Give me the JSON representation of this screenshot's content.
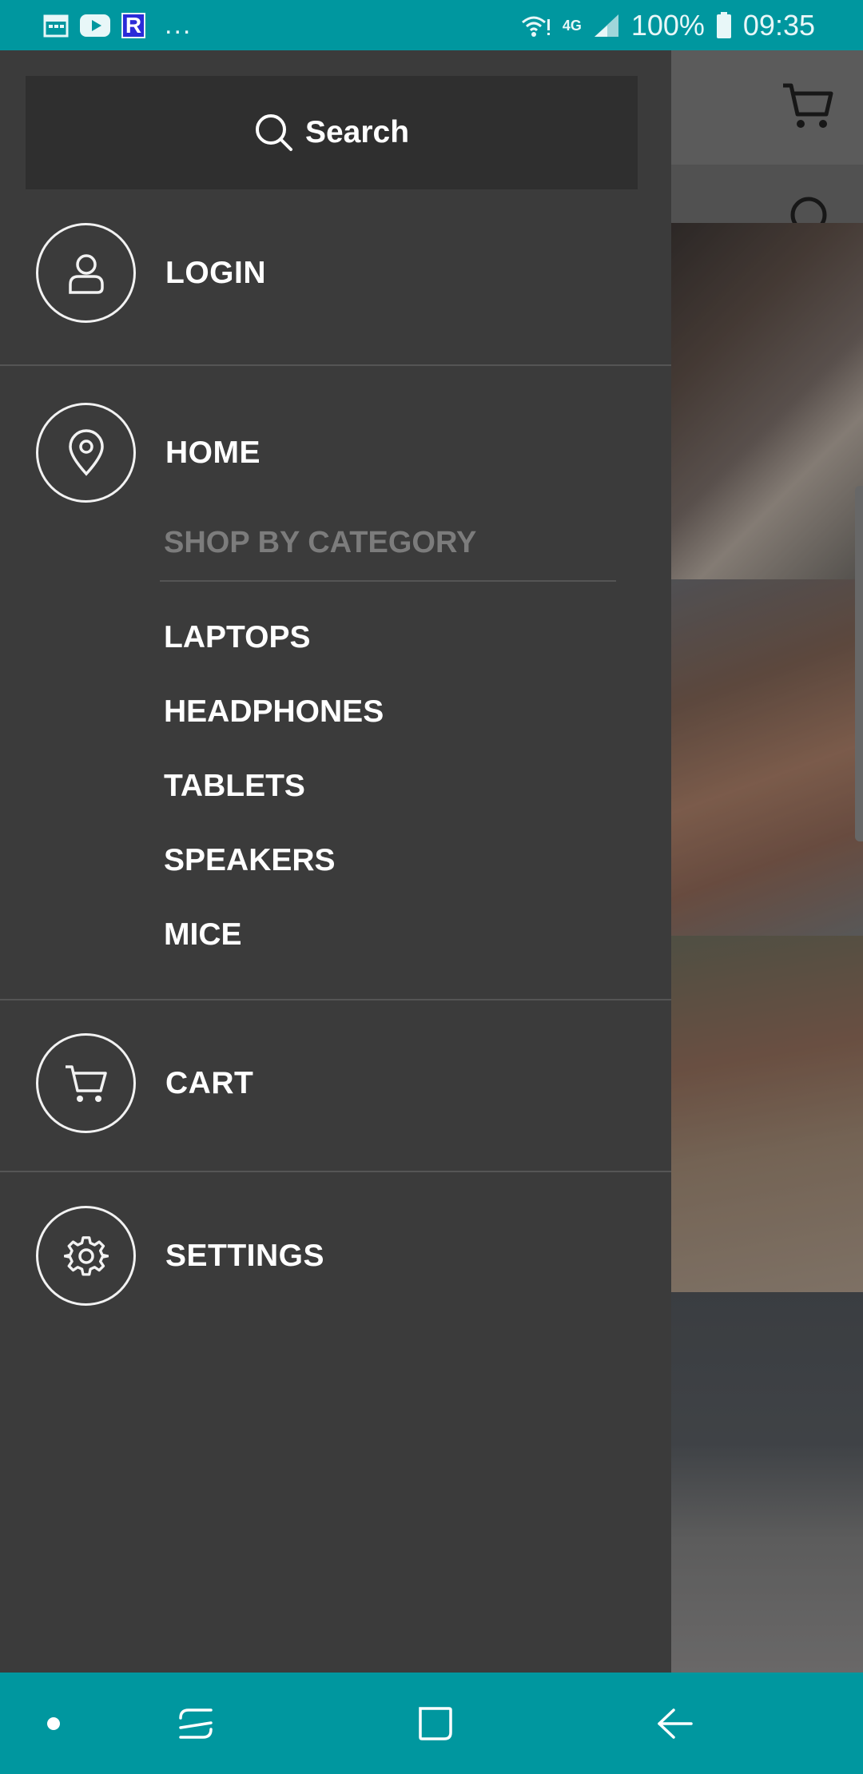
{
  "status_bar": {
    "battery": "100%",
    "time": "09:35",
    "notification_overflow": "...",
    "network": "4G",
    "app_icon_letter": "R"
  },
  "drawer": {
    "search_label": "Search",
    "items": {
      "login": "LOGIN",
      "home": "HOME",
      "cart": "CART",
      "settings": "SETTINGS"
    },
    "category_header": "SHOP BY CATEGORY",
    "categories": [
      "LAPTOPS",
      "HEADPHONES",
      "TABLETS",
      "SPEAKERS",
      "MICE"
    ]
  },
  "icons": {
    "login": "user-icon",
    "home": "map-pin-icon",
    "cart": "cart-icon",
    "settings": "gear-icon",
    "search": "search-icon"
  },
  "colors": {
    "status_bar": "#00979f",
    "drawer_background": "#3b3b3b",
    "search_box": "#2f2f2f",
    "category_header": "#7c7c7c",
    "text": "#ffffff"
  }
}
